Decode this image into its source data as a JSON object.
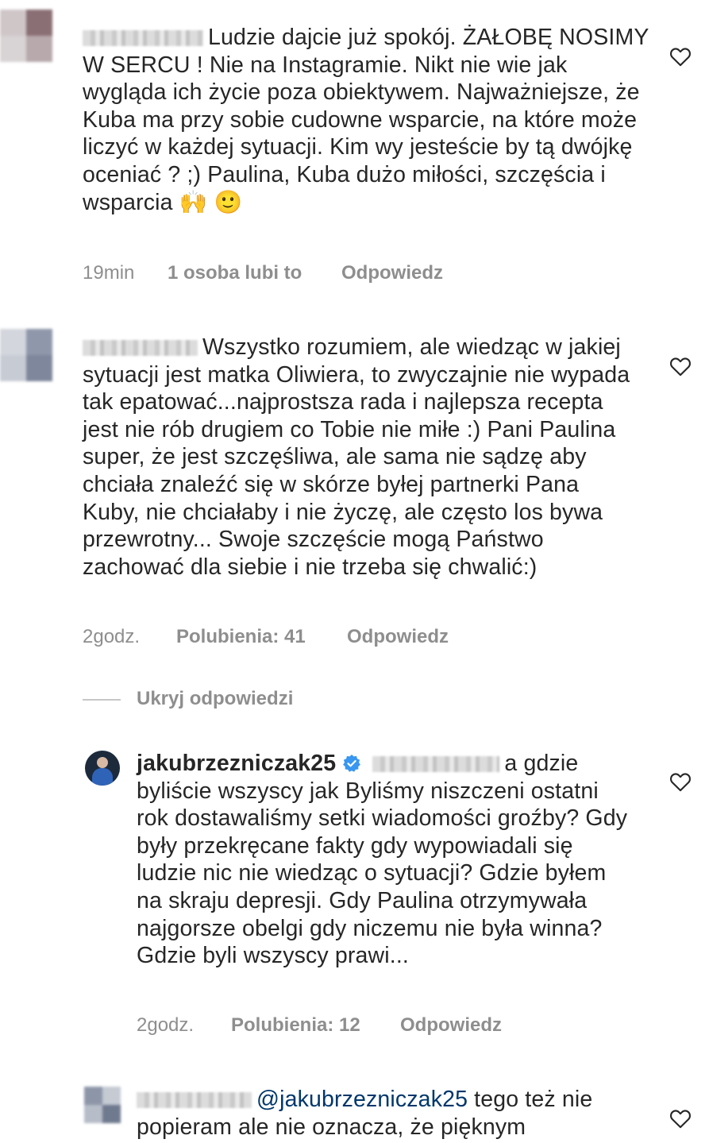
{
  "comments": [
    {
      "text": "Ludzie dajcie już spokój. ŻAŁOBĘ NOSIMY W SERCU !  Nie na Instagramie. Nikt nie wie jak wygląda ich życie poza obiektywem. Najważniejsze, że Kuba ma przy sobie cudowne wsparcie, na które może liczyć w każdej sytuacji. Kim wy jesteście by tą dwójkę oceniać ? ;) Paulina, Kuba dużo miłości, szczęścia i wsparcia",
      "emoji": "🙌 🙂",
      "time": "19min",
      "likes": "1 osoba lubi to",
      "reply": "Odpowiedz"
    },
    {
      "text": "Wszystko rozumiem, ale wiedząc w jakiej sytuacji jest matka Oliwiera, to zwyczajnie nie wypada tak epatować...najprostsza rada i najlepsza recepta jest nie rób drugiem co Tobie nie miłe :) Pani Paulina super, że jest szczęśliwa, ale sama nie sądzę aby chciała znaleźć się w skórze byłej partnerki Pana Kuby, nie chciałaby i nie życzę, ale często los bywa przewrotny... Swoje szczęście mogą Państwo zachować dla siebie i nie trzeba się chwalić:)",
      "time": "2godz.",
      "likes": "Polubienia: 41",
      "reply": "Odpowiedz"
    },
    {
      "username": "jakubrzezniczak25",
      "text": "a gdzie byliście wszyscy jak Byliśmy niszczeni ostatni rok dostawaliśmy setki wiadomości groźby? Gdy były przekręcane fakty gdy wypowiadali się ludzie nic nie wiedząc o sytuacji? Gdzie byłem na skraju depresji. Gdy Paulina otrzymywała najgorsze obelgi gdy niczemu nie była winna? Gdzie byli wszyscy prawi...",
      "time": "2godz.",
      "likes": "Polubienia: 12",
      "reply": "Odpowiedz"
    },
    {
      "mention": "@jakubrzezniczak25",
      "text": "tego też nie popieram ale nie oznacza, że pięknym"
    }
  ],
  "hide_replies": "Ukryj odpowiedzi",
  "colors": {
    "text": "#262626",
    "meta": "#8e8e8e",
    "verified": "#3897f0",
    "mention": "#00376b"
  },
  "icons": [
    "heart-outline-icon",
    "verified-badge-icon"
  ]
}
